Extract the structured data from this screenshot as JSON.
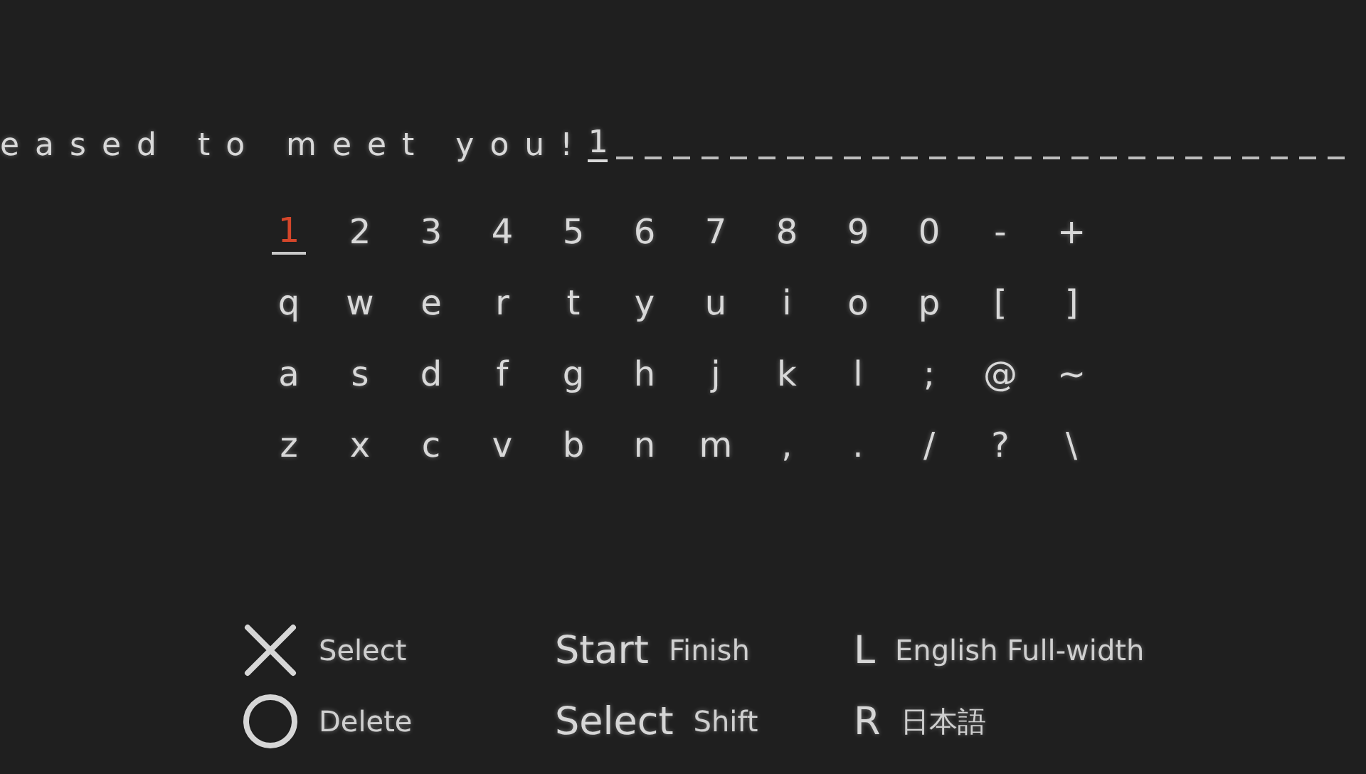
{
  "entry": {
    "text": "eased to meet you!",
    "cursor_char": "1"
  },
  "keyboard": {
    "rows": [
      [
        {
          "label": "1",
          "selected": true
        },
        {
          "label": "2",
          "selected": false
        },
        {
          "label": "3",
          "selected": false
        },
        {
          "label": "4",
          "selected": false
        },
        {
          "label": "5",
          "selected": false
        },
        {
          "label": "6",
          "selected": false
        },
        {
          "label": "7",
          "selected": false
        },
        {
          "label": "8",
          "selected": false
        },
        {
          "label": "9",
          "selected": false
        },
        {
          "label": "0",
          "selected": false
        },
        {
          "label": "-",
          "selected": false
        },
        {
          "label": "+",
          "selected": false
        }
      ],
      [
        {
          "label": "q",
          "selected": false
        },
        {
          "label": "w",
          "selected": false
        },
        {
          "label": "e",
          "selected": false
        },
        {
          "label": "r",
          "selected": false
        },
        {
          "label": "t",
          "selected": false
        },
        {
          "label": "y",
          "selected": false
        },
        {
          "label": "u",
          "selected": false
        },
        {
          "label": "i",
          "selected": false
        },
        {
          "label": "o",
          "selected": false
        },
        {
          "label": "p",
          "selected": false
        },
        {
          "label": "[",
          "selected": false
        },
        {
          "label": "]",
          "selected": false
        }
      ],
      [
        {
          "label": "a",
          "selected": false
        },
        {
          "label": "s",
          "selected": false
        },
        {
          "label": "d",
          "selected": false
        },
        {
          "label": "f",
          "selected": false
        },
        {
          "label": "g",
          "selected": false
        },
        {
          "label": "h",
          "selected": false
        },
        {
          "label": "j",
          "selected": false
        },
        {
          "label": "k",
          "selected": false
        },
        {
          "label": "l",
          "selected": false
        },
        {
          "label": ";",
          "selected": false
        },
        {
          "label": "@",
          "selected": false
        },
        {
          "label": "~",
          "selected": false
        }
      ],
      [
        {
          "label": "z",
          "selected": false
        },
        {
          "label": "x",
          "selected": false
        },
        {
          "label": "c",
          "selected": false
        },
        {
          "label": "v",
          "selected": false
        },
        {
          "label": "b",
          "selected": false
        },
        {
          "label": "n",
          "selected": false
        },
        {
          "label": "m",
          "selected": false
        },
        {
          "label": ",",
          "selected": false
        },
        {
          "label": ".",
          "selected": false
        },
        {
          "label": "/",
          "selected": false
        },
        {
          "label": "?",
          "selected": false
        },
        {
          "label": "\\",
          "selected": false
        }
      ]
    ]
  },
  "legend": [
    [
      {
        "kind": "cross",
        "action": "Select"
      },
      {
        "kind": "circle",
        "action": "Delete"
      }
    ],
    [
      {
        "kind": "key",
        "key": "Start",
        "action": "Finish"
      },
      {
        "kind": "key",
        "key": "Select",
        "action": "Shift"
      }
    ],
    [
      {
        "kind": "key",
        "key": "L",
        "action": "English Full-width"
      },
      {
        "kind": "key",
        "key": "R",
        "action": "日本語"
      }
    ]
  ]
}
